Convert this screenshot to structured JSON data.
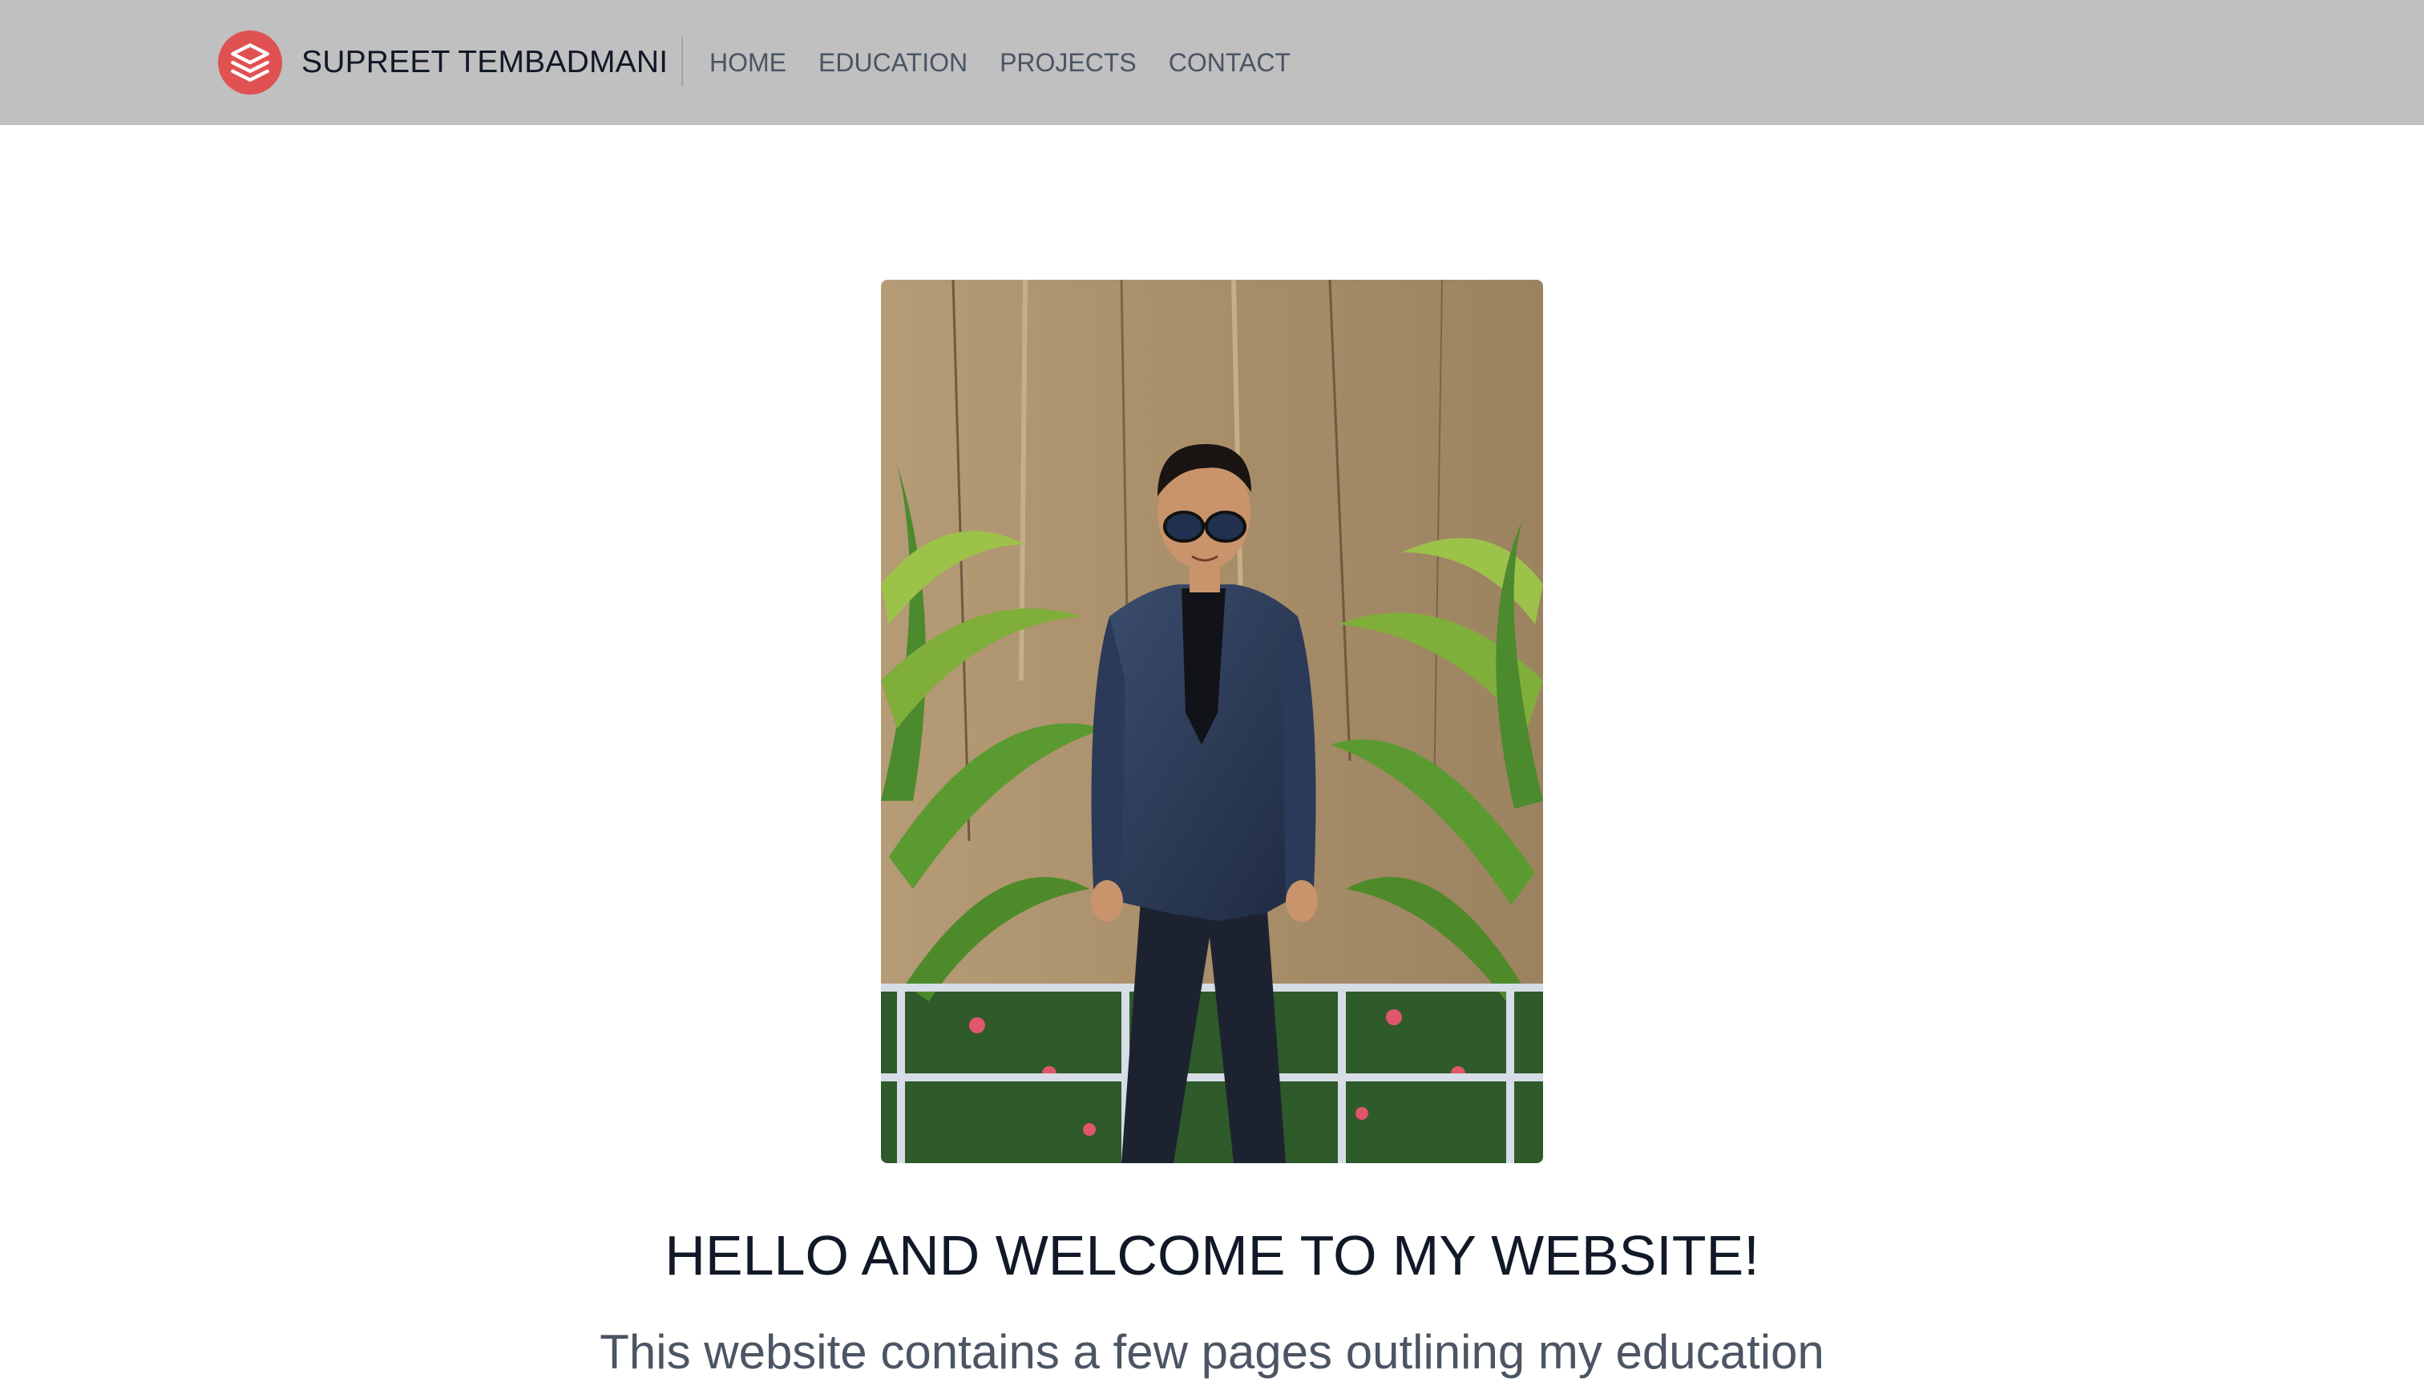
{
  "header": {
    "logo_icon": "layers-icon",
    "brand_name": "SUPREET TEMBADMANI",
    "nav": [
      {
        "label": "HOME"
      },
      {
        "label": "EDUCATION"
      },
      {
        "label": "PROJECTS"
      },
      {
        "label": "CONTACT"
      }
    ]
  },
  "main": {
    "headline": "HELLO AND WELCOME TO MY WEBSITE!",
    "subtext": "This website contains a few pages outlining my education"
  },
  "colors": {
    "navbar_bg": "#c0c0c0",
    "logo_bg": "#e05252",
    "heading": "#111827",
    "body_text": "#4b5563"
  }
}
